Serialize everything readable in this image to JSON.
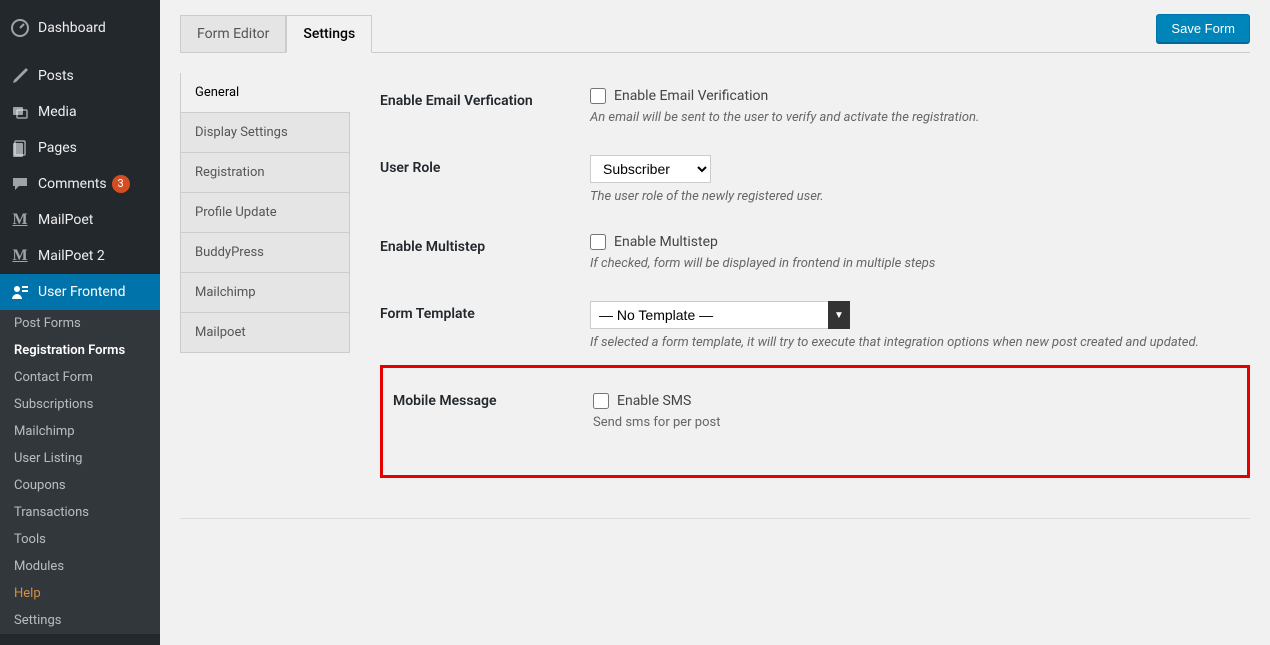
{
  "sidebar": {
    "items": [
      {
        "label": "Dashboard",
        "icon": "dashboard-icon"
      },
      {
        "label": "Posts",
        "icon": "posts-icon"
      },
      {
        "label": "Media",
        "icon": "media-icon"
      },
      {
        "label": "Pages",
        "icon": "pages-icon"
      },
      {
        "label": "Comments",
        "icon": "comments-icon",
        "badge": "3"
      },
      {
        "label": "MailPoet",
        "icon": "mailpoet-icon"
      },
      {
        "label": "MailPoet 2",
        "icon": "mailpoet-icon"
      },
      {
        "label": "User Frontend",
        "icon": "user-frontend-icon",
        "active": true
      }
    ],
    "sub_items": [
      {
        "label": "Post Forms"
      },
      {
        "label": "Registration Forms",
        "current": true
      },
      {
        "label": "Contact Form"
      },
      {
        "label": "Subscriptions"
      },
      {
        "label": "Mailchimp"
      },
      {
        "label": "User Listing"
      },
      {
        "label": "Coupons"
      },
      {
        "label": "Transactions"
      },
      {
        "label": "Tools"
      },
      {
        "label": "Modules"
      },
      {
        "label": "Help",
        "help": true
      },
      {
        "label": "Settings"
      }
    ]
  },
  "header": {
    "tabs": [
      {
        "label": "Form Editor",
        "active": false
      },
      {
        "label": "Settings",
        "active": true
      }
    ],
    "save_button": "Save Form"
  },
  "settings_tabs": [
    {
      "label": "General",
      "active": true
    },
    {
      "label": "Display Settings"
    },
    {
      "label": "Registration"
    },
    {
      "label": "Profile Update"
    },
    {
      "label": "BuddyPress"
    },
    {
      "label": "Mailchimp"
    },
    {
      "label": "Mailpoet"
    }
  ],
  "form": {
    "email_verification": {
      "label": "Enable Email Verfication",
      "checkbox_label": "Enable Email Verification",
      "desc": "An email will be sent to the user to verify and activate the registration."
    },
    "user_role": {
      "label": "User Role",
      "selected": "Subscriber",
      "desc": "The user role of the newly registered user."
    },
    "multistep": {
      "label": "Enable Multistep",
      "checkbox_label": "Enable Multistep",
      "desc": "If checked, form will be displayed in frontend in multiple steps"
    },
    "template": {
      "label": "Form Template",
      "selected": "— No Template —",
      "desc": "If selected a form template, it will try to execute that integration options when new post created and updated."
    },
    "mobile": {
      "label": "Mobile Message",
      "checkbox_label": "Enable SMS",
      "desc": "Send sms for per post"
    }
  }
}
